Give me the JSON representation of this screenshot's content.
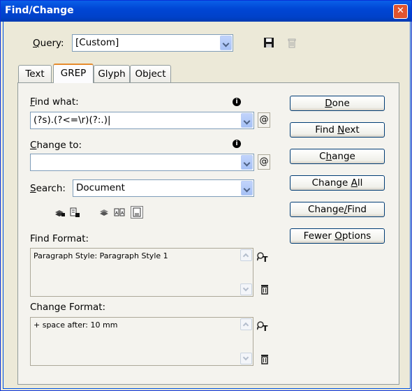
{
  "window": {
    "title": "Find/Change",
    "close_glyph": "✕"
  },
  "query": {
    "label_prefix": "",
    "label_u": "Q",
    "label_rest": "uery:",
    "value": "[Custom]"
  },
  "tabs": [
    {
      "label": "Text"
    },
    {
      "label": "GREP"
    },
    {
      "label": "Glyph"
    },
    {
      "label": "Object"
    }
  ],
  "find_what": {
    "label_u": "F",
    "label_rest": "ind what:",
    "value": "(?s).(?<=\\r)(?:.)|"
  },
  "change_to": {
    "label_u": "C",
    "label_rest": "hange to:",
    "value": ""
  },
  "search": {
    "label_u": "S",
    "label_rest": "earch:",
    "value": "Document"
  },
  "find_format": {
    "label": "Find Format:",
    "value": "Paragraph Style: Paragraph Style 1"
  },
  "change_format": {
    "label": "Change Format:",
    "value": "+ space after: 10 mm"
  },
  "buttons": {
    "done": {
      "pre": "",
      "u": "D",
      "post": "one"
    },
    "find_next": {
      "pre": "Find ",
      "u": "N",
      "post": "ext"
    },
    "change": {
      "pre": "C",
      "u": "h",
      "post": "ange"
    },
    "change_all": {
      "pre": "Change ",
      "u": "A",
      "post": "ll"
    },
    "change_find": {
      "pre": "Change",
      "u": "/",
      "post": "Find"
    },
    "fewer_options": {
      "pre": "Fewer ",
      "u": "O",
      "post": "ptions"
    }
  },
  "icons": {
    "info": "i",
    "at": "@",
    "save_query": "floppy-disk-icon",
    "delete_query": "trash-icon"
  }
}
